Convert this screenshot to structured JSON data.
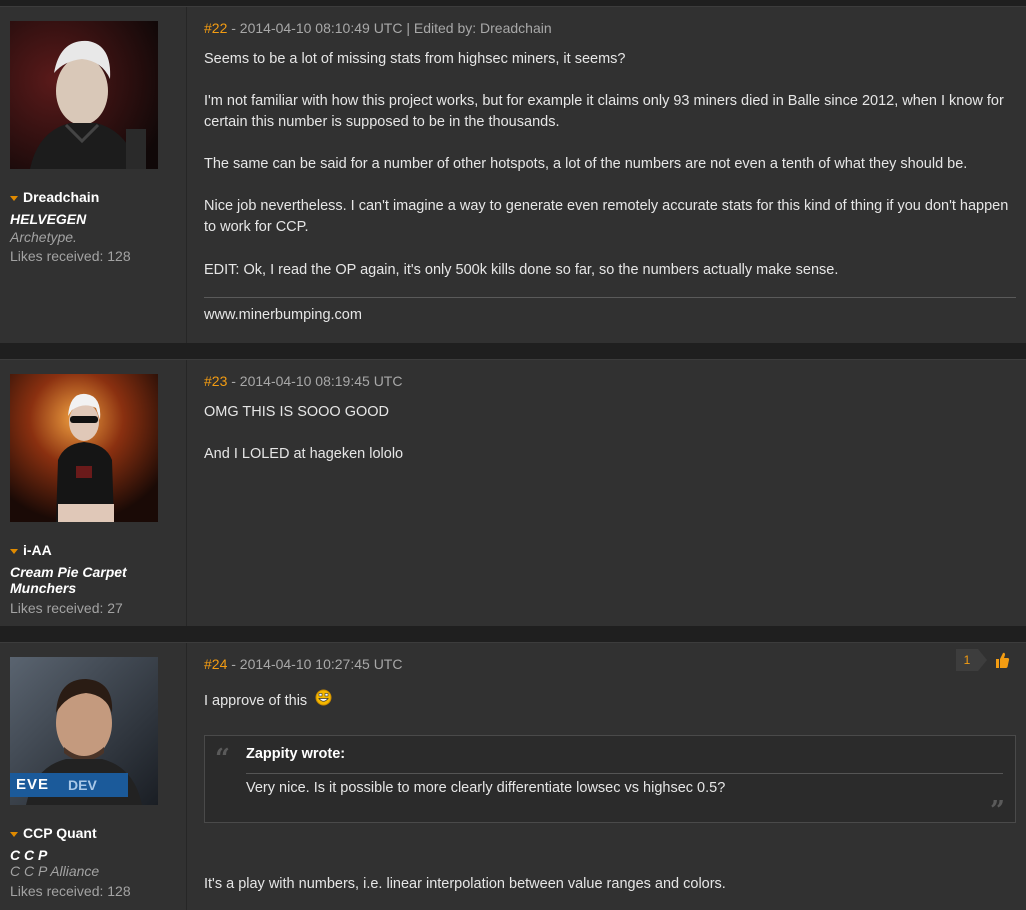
{
  "posts": [
    {
      "number": "#22",
      "meta": " - 2014-04-10 08:10:49 UTC  |  Edited by: Dreadchain",
      "user": {
        "name": "Dreadchain",
        "corp": "HELVEGEN",
        "alliance": "Archetype.",
        "likes": "Likes received: 128",
        "avatar_icon": "character-portrait-white-hair"
      },
      "paragraphs": [
        "Seems to be a lot of missing stats from highsec miners, it seems?",
        "I'm not familiar with how this project works, but for example it claims only 93 miners died in Balle since 2012, when I know for certain this number is supposed to be in the thousands.",
        "The same can be said for a number of other hotspots, a lot of the numbers are not even a tenth of what they should be.",
        "Nice job nevertheless. I can't imagine a way to generate even remotely accurate stats for this kind of thing if you don't happen to work for CCP.",
        "EDIT: Ok, I read the OP again, it's only 500k kills done so far, so the numbers actually make sense."
      ],
      "signature": "www.minerbumping.com"
    },
    {
      "number": "#23",
      "meta": " - 2014-04-10 08:19:45 UTC",
      "user": {
        "name": "i-AA",
        "corp": "Cream Pie Carpet Munchers",
        "likes": "Likes received: 27",
        "avatar_icon": "character-portrait-sunglasses"
      },
      "paragraphs": [
        "OMG THIS IS SOOO GOOD",
        "And I LOLED at hageken lololo"
      ]
    },
    {
      "number": "#24",
      "meta": " - 2014-04-10 10:27:45 UTC",
      "like_count": "1",
      "user": {
        "name": "CCP Quant",
        "corp": "C C P",
        "alliance": "C C P Alliance",
        "likes": "Likes received: 128",
        "avatar_icon": "character-portrait-dev",
        "badge_eve": "EVE",
        "badge_dev": "DEV"
      },
      "paragraphs": [
        "I approve of this",
        "It's a play with numbers, i.e. linear interpolation between value ranges and colors."
      ],
      "quote": {
        "author": "Zappity wrote:",
        "text": "Very nice. Is it possible to more clearly differentiate lowsec vs highsec 0.5?"
      }
    }
  ],
  "colors": {
    "accent": "#f39c12",
    "background": "#1f1f1f",
    "post_background": "#313131",
    "muted_text": "#a3a3a3"
  }
}
